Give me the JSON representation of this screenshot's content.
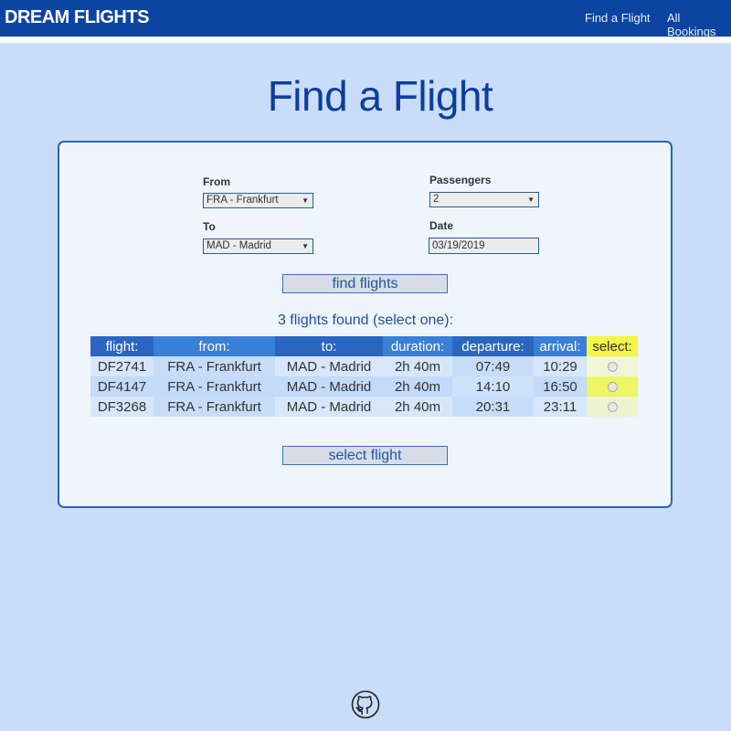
{
  "header": {
    "brand": "DREAM FLIGHTS",
    "links": [
      "Find a Flight",
      "All Bookings"
    ]
  },
  "page": {
    "title": "Find a Flight"
  },
  "form": {
    "from_label": "From",
    "from_value": "FRA - Frankfurt",
    "to_label": "To",
    "to_value": "MAD - Madrid",
    "passengers_label": "Passengers",
    "passengers_value": "2",
    "date_label": "Date",
    "date_value": "03/19/2019",
    "find_button": "find flights"
  },
  "results": {
    "summary": "3 flights found (select one):",
    "columns": [
      "flight:",
      "from:",
      "to:",
      "duration:",
      "departure:",
      "arrival:",
      "select:"
    ],
    "rows": [
      [
        "DF2741",
        "FRA - Frankfurt",
        "MAD - Madrid",
        "2h 40m",
        "07:49",
        "10:29"
      ],
      [
        "DF4147",
        "FRA - Frankfurt",
        "MAD - Madrid",
        "2h 40m",
        "14:10",
        "16:50"
      ],
      [
        "DF3268",
        "FRA - Frankfurt",
        "MAD - Madrid",
        "2h 40m",
        "20:31",
        "23:11"
      ]
    ],
    "select_button": "select flight"
  },
  "footer": {
    "icon": "github-icon"
  },
  "colors": {
    "navbar": "#0c44a1",
    "background": "#c9ddfb",
    "accent": "#0d3e9a",
    "select_header": "#f3f549"
  }
}
